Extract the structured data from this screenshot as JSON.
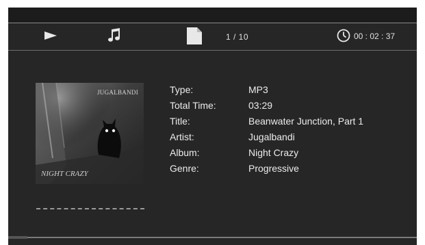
{
  "status_bar": {
    "playback_state_icon": "play-icon",
    "media_type_icon": "music-note-icon",
    "file_icon": "file-icon",
    "track_counter": "1  /  10",
    "clock_icon": "clock-icon",
    "elapsed_time": "00 : 02 : 37"
  },
  "album_art": {
    "label_top": "JUGALBANDI",
    "label_bottom": "NIGHT CRAZY"
  },
  "track_info": [
    {
      "label": "Type:",
      "value": "MP3"
    },
    {
      "label": "Total Time:",
      "value": "03:29"
    },
    {
      "label": "Title:",
      "value": "Beanwater Junction, Part 1"
    },
    {
      "label": "Artist:",
      "value": "Jugalbandi"
    },
    {
      "label": "Album:",
      "value": "Night Crazy"
    },
    {
      "label": "Genre:",
      "value": "Progressive"
    }
  ],
  "colors": {
    "background": "#262626",
    "text": "#ececec",
    "divider": "#8a8a8a"
  }
}
